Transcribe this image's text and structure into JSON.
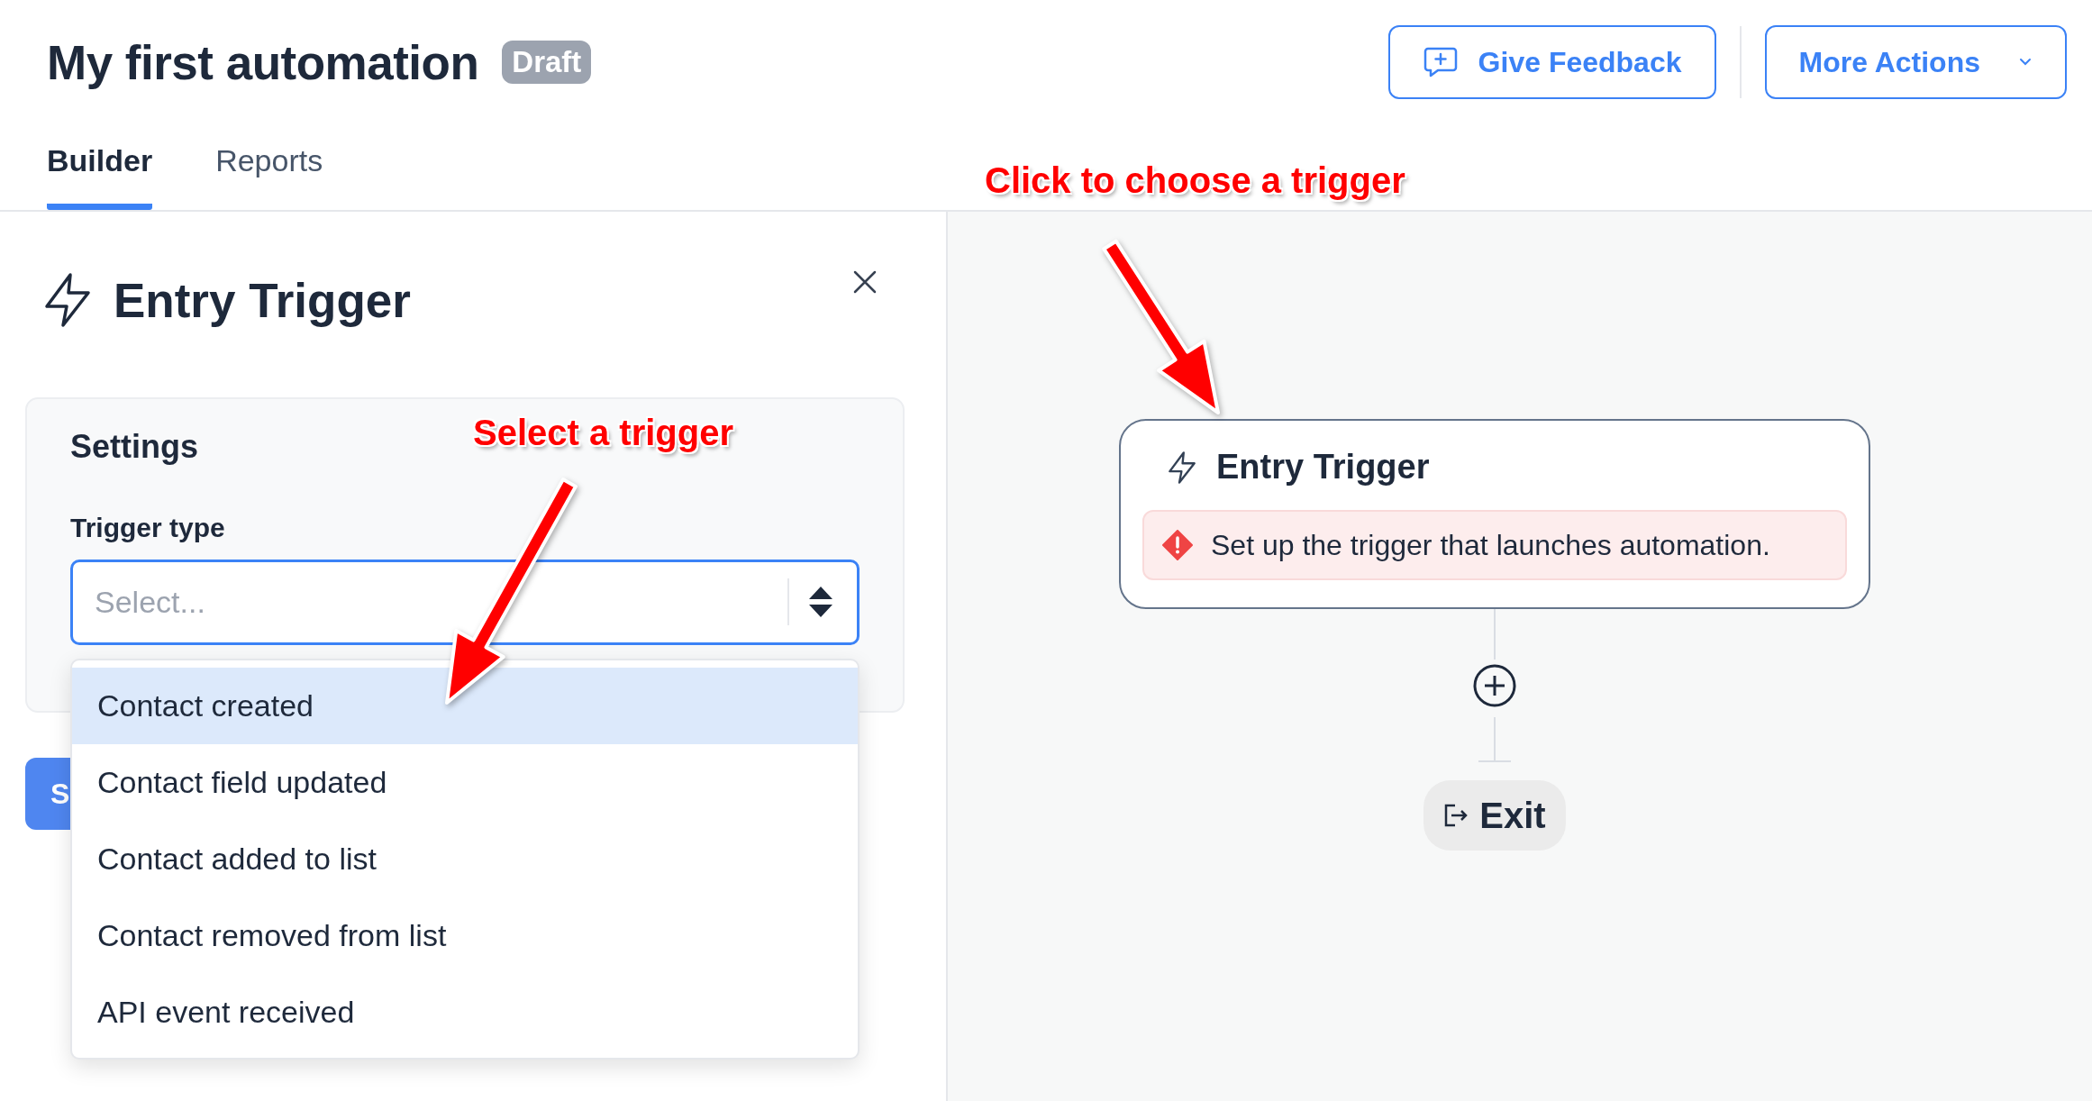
{
  "header": {
    "title": "My first automation",
    "status_badge": "Draft",
    "buttons": [
      {
        "label": "Give Feedback",
        "kind": "feedback"
      },
      {
        "label": "More Actions",
        "kind": "menu"
      }
    ]
  },
  "tabs": [
    {
      "label": "Builder",
      "selected": true
    },
    {
      "label": "Reports",
      "selected": false
    }
  ],
  "panel": {
    "title": "Entry Trigger",
    "settings": {
      "heading": "Settings",
      "field_label": "Trigger type",
      "placeholder": "Select...",
      "options": [
        {
          "label": "Contact created",
          "selected": true
        },
        {
          "label": "Contact field updated",
          "selected": false
        },
        {
          "label": "Contact added to list",
          "selected": false
        },
        {
          "label": "Contact removed from list",
          "selected": false
        },
        {
          "label": "API event received",
          "selected": false
        }
      ]
    },
    "button_label": "S"
  },
  "canvas": {
    "nodes": [
      {
        "kind": "trigger",
        "title": "Entry Trigger",
        "error": "Set up the trigger that launches automation."
      },
      {
        "kind": "add"
      },
      {
        "kind": "exit",
        "label": "Exit"
      }
    ]
  },
  "annotations": [
    {
      "text": "Click to choose a trigger"
    },
    {
      "text": "Select a trigger"
    }
  ]
}
